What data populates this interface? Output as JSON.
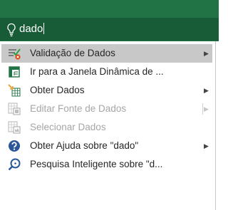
{
  "search": {
    "query": "dado",
    "icon": "lightbulb-icon"
  },
  "colors": {
    "ribbon_green": "#217346",
    "search_bg": "#185c37",
    "selected_bg": "#c8c8c8",
    "disabled_text": "#a6a6a6",
    "help_blue": "#2b579a"
  },
  "menu": {
    "items": [
      {
        "label": "Validação de Dados",
        "icon": "data-validation-icon",
        "has_submenu": true,
        "selected": true,
        "enabled": true
      },
      {
        "label": "Ir para a Janela Dinâmica de ...",
        "icon": "pivot-window-icon",
        "has_submenu": false,
        "selected": false,
        "enabled": true
      },
      {
        "label": "Obter Dados",
        "icon": "get-data-icon",
        "has_submenu": true,
        "selected": false,
        "enabled": true
      },
      {
        "label": "Editar Fonte de Dados",
        "icon": "edit-data-source-icon",
        "has_submenu": true,
        "selected": false,
        "enabled": false
      },
      {
        "label": "Selecionar Dados",
        "icon": "select-data-icon",
        "has_submenu": false,
        "selected": false,
        "enabled": false
      },
      {
        "label": "Obter Ajuda sobre \"dado\"",
        "icon": "help-icon",
        "has_submenu": true,
        "selected": false,
        "enabled": true
      },
      {
        "label": "Pesquisa Inteligente sobre \"d...",
        "icon": "smart-lookup-icon",
        "has_submenu": false,
        "selected": false,
        "enabled": true
      }
    ]
  }
}
